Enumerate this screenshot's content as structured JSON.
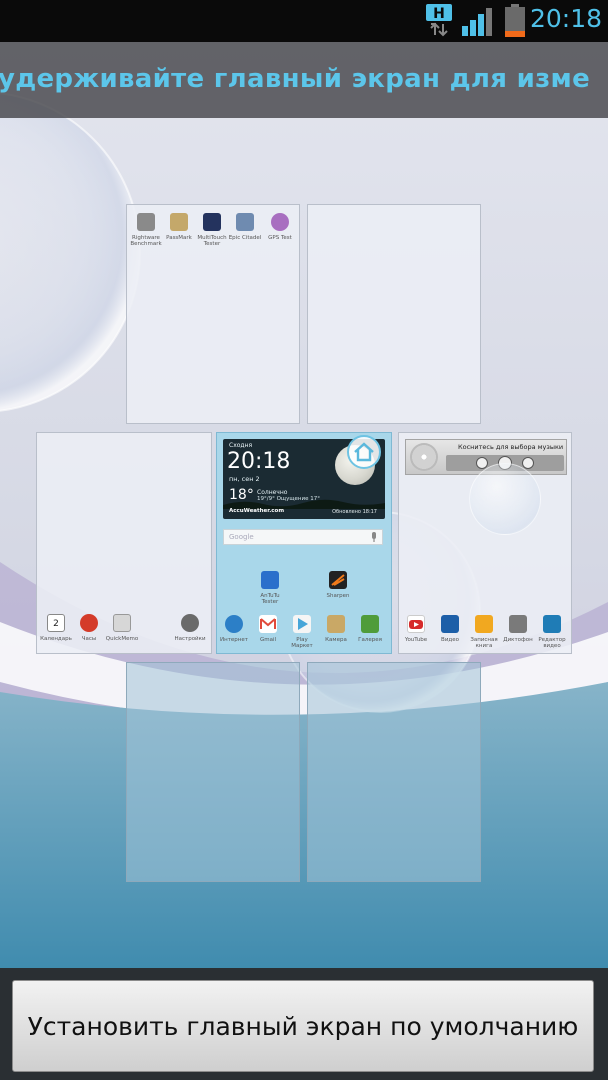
{
  "status_bar": {
    "time": "20:18",
    "network_type": "H",
    "icons": [
      "data-transfer-icon",
      "signal-icon",
      "battery-icon"
    ]
  },
  "hint": {
    "text": "те и удерживайте главный экран для изме"
  },
  "screens": {
    "top_left": {
      "apps": [
        {
          "label": "Rightware Benchmark",
          "icon": "benchmark-icon",
          "color": "#8a8a8a"
        },
        {
          "label": "PassMark",
          "icon": "passmark-icon",
          "color": "#c4a86a"
        },
        {
          "label": "MultiTouch Tester",
          "icon": "multitouch-icon",
          "color": "#24335e"
        },
        {
          "label": "Epic Citadel",
          "icon": "citadel-icon",
          "color": "#6f8bb0"
        },
        {
          "label": "GPS Test",
          "icon": "gps-icon",
          "color": "#a86fc0"
        }
      ]
    },
    "middle_left": {
      "apps": [
        {
          "label": "Календарь",
          "icon": "calendar-icon",
          "color": "#ffffff"
        },
        {
          "label": "Часы",
          "icon": "clock-icon",
          "color": "#d43b2a"
        },
        {
          "label": "QuickMemo",
          "icon": "quickmemo-icon",
          "color": "#d7d7d7"
        },
        {
          "label": "Настройки",
          "icon": "settings-icon",
          "color": "#6a6a6a"
        }
      ],
      "calendar_day": "2"
    },
    "current": {
      "weather": {
        "location": "Сходня",
        "time": "20:18",
        "date": "пн, сен 2",
        "temp": "18°",
        "condition": "Солнечно",
        "range": "19°/9° Ощущение 17°",
        "brand": "AccuWeather.com",
        "updated": "Обновлено 18:17"
      },
      "search_label": "Google",
      "apps": [
        {
          "label": "AnTuTu Tester",
          "icon": "antutu-icon",
          "color": "#2a6fcb"
        },
        {
          "label": "Sharpen",
          "icon": "sharpen-icon",
          "color": "#f07a1a"
        }
      ],
      "dock": [
        {
          "label": "Интернет",
          "icon": "browser-icon",
          "color": "#2c7fc7"
        },
        {
          "label": "Gmail",
          "icon": "gmail-icon",
          "color": "#e14a3b"
        },
        {
          "label": "Play Маркет",
          "icon": "play-store-icon",
          "color": "#f5f5f5"
        },
        {
          "label": "Камера",
          "icon": "camera-icon",
          "color": "#c9a866"
        },
        {
          "label": "Галерея",
          "icon": "gallery-icon",
          "color": "#4f9c3a"
        }
      ]
    },
    "middle_right": {
      "music_title": "Коснитесь для выбора музыки",
      "apps": [
        {
          "label": "YouTube",
          "icon": "youtube-icon",
          "color": "#d62a2a"
        },
        {
          "label": "Видео",
          "icon": "video-icon",
          "color": "#1d5fa8"
        },
        {
          "label": "Записная книга",
          "icon": "notebook-icon",
          "color": "#f1a820"
        },
        {
          "label": "Диктофон",
          "icon": "recorder-icon",
          "color": "#7a7a7a"
        },
        {
          "label": "Редактор видео",
          "icon": "video-editor-icon",
          "color": "#1f7cb6"
        }
      ]
    }
  },
  "set_default_button": "Установить главный экран по умолчанию",
  "colors": {
    "accent": "#4fc0e8",
    "status_bar": "#0a0a0a",
    "bottom_bar": "#2a2f33"
  }
}
